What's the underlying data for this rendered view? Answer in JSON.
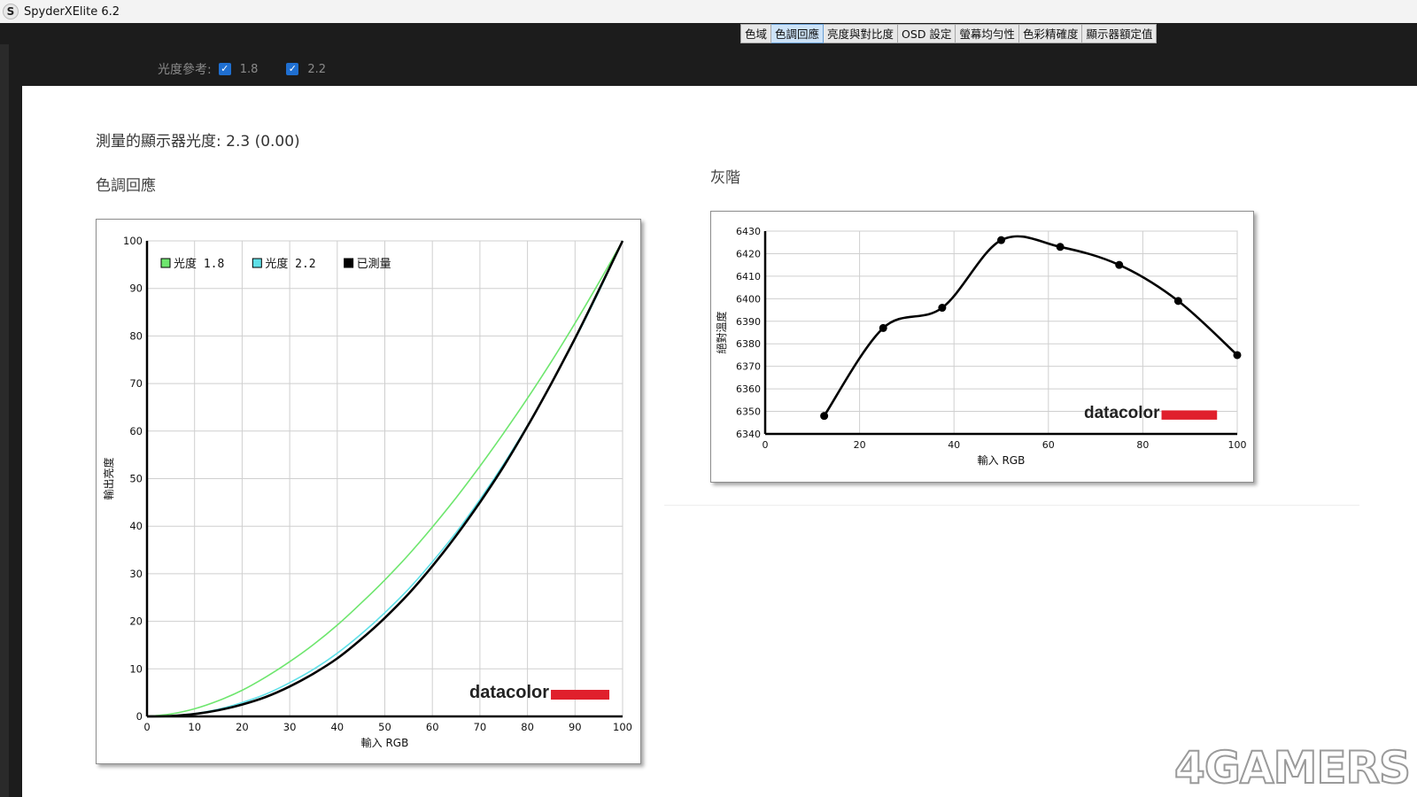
{
  "window": {
    "title": "SpyderXElite 6.2",
    "icon_letter": "S"
  },
  "tabs": [
    {
      "label": "色域",
      "active": false
    },
    {
      "label": "色調回應",
      "active": true
    },
    {
      "label": "亮度與對比度",
      "active": false
    },
    {
      "label": "OSD 設定",
      "active": false
    },
    {
      "label": "螢幕均勻性",
      "active": false
    },
    {
      "label": "色彩精確度",
      "active": false
    },
    {
      "label": "顯示器額定值",
      "active": false
    }
  ],
  "gamma_ref": {
    "label": "光度參考:",
    "options": [
      {
        "label": "1.8",
        "checked": true
      },
      {
        "label": "2.2",
        "checked": true
      }
    ]
  },
  "measured": {
    "text": "測量的顯示器光度: 2.3 (0.00)"
  },
  "tone_section": {
    "heading": "色調回應"
  },
  "gray_section": {
    "heading": "灰階"
  },
  "brand": {
    "text": "datacolor",
    "color": "#e0202c"
  },
  "watermark": {
    "text": "4GAMERS"
  },
  "chart_data": [
    {
      "type": "line",
      "xlabel": "輸入 RGB",
      "ylabel": "輸出亮度",
      "xlim": [
        0,
        100
      ],
      "ylim": [
        0,
        100
      ],
      "xticks": [
        0,
        10,
        20,
        30,
        40,
        50,
        60,
        70,
        80,
        90,
        100
      ],
      "yticks": [
        0,
        10,
        20,
        30,
        40,
        50,
        60,
        70,
        80,
        90,
        100
      ],
      "grid": true,
      "legend_position": "top-left",
      "series": [
        {
          "name": "光度 1.8",
          "color": "#6ee66e",
          "x": [
            0,
            5,
            10,
            15,
            20,
            25,
            30,
            35,
            40,
            45,
            50,
            55,
            60,
            65,
            70,
            75,
            80,
            85,
            90,
            95,
            100
          ],
          "y": [
            0,
            0.5,
            1.6,
            3.3,
            5.5,
            8.3,
            11.5,
            15.1,
            19.2,
            23.8,
            28.7,
            34.0,
            39.8,
            46.0,
            52.6,
            59.6,
            66.9,
            74.6,
            82.7,
            91.2,
            100
          ]
        },
        {
          "name": "光度 2.2",
          "color": "#5fe0e8",
          "x": [
            0,
            5,
            10,
            15,
            20,
            25,
            30,
            35,
            40,
            45,
            50,
            55,
            60,
            65,
            70,
            75,
            80,
            85,
            90,
            95,
            100
          ],
          "y": [
            0,
            0.1,
            0.6,
            1.5,
            2.9,
            4.7,
            7.1,
            9.9,
            13.3,
            17.3,
            21.8,
            26.8,
            32.5,
            38.7,
            45.6,
            53.1,
            61.2,
            70.0,
            79.3,
            89.3,
            100
          ]
        },
        {
          "name": "已測量",
          "color": "#000000",
          "x": [
            0,
            5,
            10,
            15,
            20,
            25,
            30,
            35,
            40,
            45,
            50,
            55,
            60,
            65,
            70,
            75,
            80,
            85,
            90,
            95,
            100
          ],
          "y": [
            0,
            0.1,
            0.5,
            1.3,
            2.5,
            4.1,
            6.3,
            9.0,
            12.2,
            16.2,
            20.7,
            25.8,
            31.6,
            38.0,
            45.0,
            52.6,
            61.0,
            70.0,
            79.5,
            89.6,
            100
          ]
        }
      ]
    },
    {
      "type": "line",
      "xlabel": "輸入 RGB",
      "ylabel": "絕對溫度",
      "xlim": [
        0,
        100
      ],
      "ylim": [
        6340,
        6430
      ],
      "xticks": [
        0,
        20,
        40,
        60,
        80,
        100
      ],
      "yticks": [
        6340,
        6350,
        6360,
        6370,
        6380,
        6390,
        6400,
        6410,
        6420,
        6430
      ],
      "grid": true,
      "series": [
        {
          "color": "#000000",
          "x": [
            12.5,
            25,
            37.5,
            50,
            62.5,
            75,
            87.5,
            100
          ],
          "y": [
            6348,
            6387,
            6396,
            6426,
            6423,
            6415,
            6399,
            6375
          ]
        }
      ]
    }
  ]
}
